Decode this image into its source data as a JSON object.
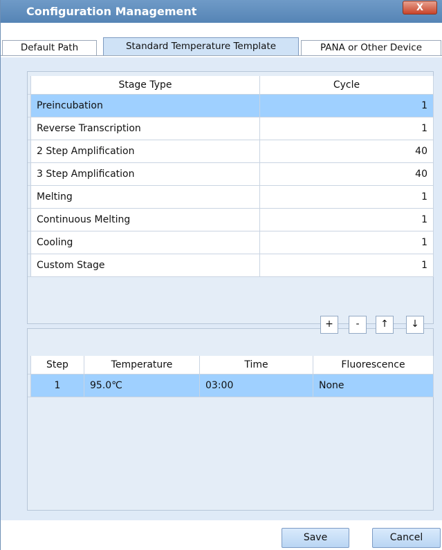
{
  "window": {
    "title": "Configuration Management",
    "close_label": "X"
  },
  "tabs": [
    "Default Path",
    "Standard Temperature Template",
    "PANA or Other Device"
  ],
  "stages": {
    "headers": [
      "Stage Type",
      "Cycle"
    ],
    "rows": [
      {
        "type": "Preincubation",
        "cycle": "1"
      },
      {
        "type": "Reverse Transcription",
        "cycle": "1"
      },
      {
        "type": "2 Step Amplification",
        "cycle": "40"
      },
      {
        "type": "3 Step Amplification",
        "cycle": "40"
      },
      {
        "type": "Melting",
        "cycle": "1"
      },
      {
        "type": "Continuous Melting",
        "cycle": "1"
      },
      {
        "type": "Cooling",
        "cycle": "1"
      },
      {
        "type": "Custom Stage",
        "cycle": "1"
      }
    ]
  },
  "step_toolbar": {
    "add": "+",
    "remove": "-",
    "up": "↑",
    "down": "↓"
  },
  "steps": {
    "headers": [
      "Step",
      "Temperature",
      "Time",
      "Fluorescence"
    ],
    "rows": [
      {
        "step": "1",
        "temperature": "95.0℃",
        "time": "03:00",
        "fluorescence": "None"
      }
    ]
  },
  "footer": {
    "save_label": "Save",
    "cancel_label": "Cancel"
  },
  "colors": {
    "selection": "#9fd0ff",
    "titlebar": "#5f8dbd",
    "tab_active": "#cfe2f6"
  }
}
